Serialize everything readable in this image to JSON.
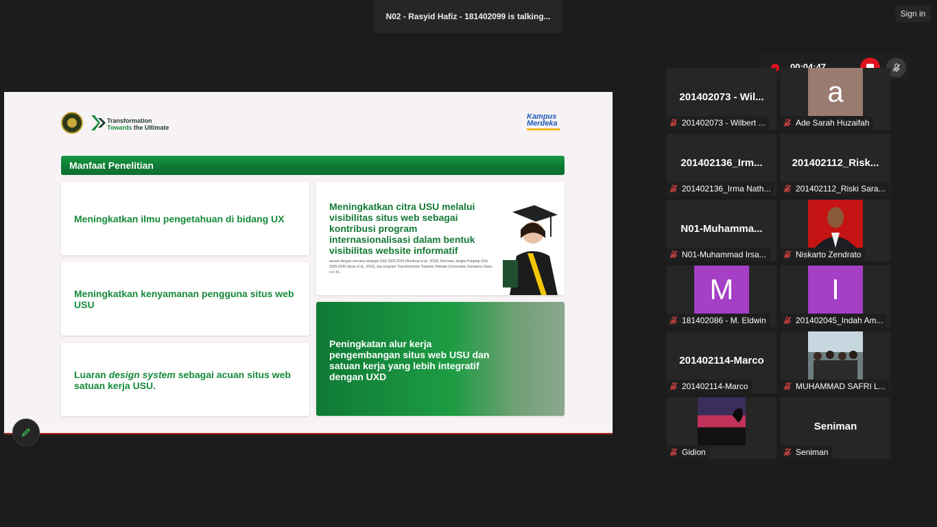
{
  "meeting": {
    "talking_banner": "N02 - Rasyid Hafiz - 181402099 is talking...",
    "sign_in_label": "Sign in"
  },
  "recording": {
    "time": "00:04:47",
    "color": "#e0141e"
  },
  "slide": {
    "brand_line1": "Transformation",
    "brand_line2_green": "Towards",
    "brand_line2_dark": "the Ultimate",
    "kampus_line1": "Kampus",
    "kampus_line2": "Merdeka",
    "header": "Manfaat Penelitian",
    "card1": "Meningkatkan ilmu pengetahuan di bidang UX",
    "card2": "Meningkatkan kenyamanan pengguna situs web USU",
    "card3_a": "Luaran ",
    "card3_b": "design system",
    "card3_c": " sebagai acuan situs web satuan kerja USU.",
    "card4_title": "Meningkatkan citra USU melalui visibilitas situs web sebagai kontribusi program internasionalisasi dalam bentuk visibilitas website informatif",
    "card4_note": "sesuai dengan rencana strategis USU 2020-2024 (Runtung et al., 2018), Rencana Jangka Panjang USU 2025-2039 (Sinar et al., 2015), dan program Transformation Towards Ultimate (Universitas Sumatera Utara, n.d.-b).",
    "card5_title": "Peningkatan alur kerja pengembangan situs web USU dan satuan kerja yang lebih integratif dengan UXD",
    "accent": "#158a3a"
  },
  "participants": [
    {
      "big": "201402073 - Wil...",
      "name": "201402073 - Wilbert ...",
      "avatar": "text"
    },
    {
      "big": "",
      "name": "Ade Sarah Huzaifah",
      "avatar": "letter",
      "letter": "a",
      "color": "#9a7b70"
    },
    {
      "big": "201402136_Irm...",
      "name": "201402136_Irma Nath...",
      "avatar": "text"
    },
    {
      "big": "201402112_Risk...",
      "name": "201402112_Riski Sara...",
      "avatar": "text"
    },
    {
      "big": "N01-Muhamma...",
      "name": "N01-Muhammad Irsa...",
      "avatar": "text"
    },
    {
      "big": "",
      "name": "Niskarto Zendrato",
      "avatar": "photo-red"
    },
    {
      "big": "",
      "name": "181402086 - M. Eldwin",
      "avatar": "letter",
      "letter": "M",
      "color": "#a43fc6"
    },
    {
      "big": "",
      "name": "201402045_Indah Am...",
      "avatar": "letter",
      "letter": "I",
      "color": "#a43fc6"
    },
    {
      "big": "201402114-Marco",
      "name": "201402114-Marco",
      "avatar": "text"
    },
    {
      "big": "",
      "name": "MUHAMMAD SAFRI L...",
      "avatar": "photo-beach"
    },
    {
      "big": "",
      "name": "Gidion",
      "avatar": "photo-sunset"
    },
    {
      "big": "Seniman",
      "name": "Seniman",
      "avatar": "text"
    }
  ]
}
